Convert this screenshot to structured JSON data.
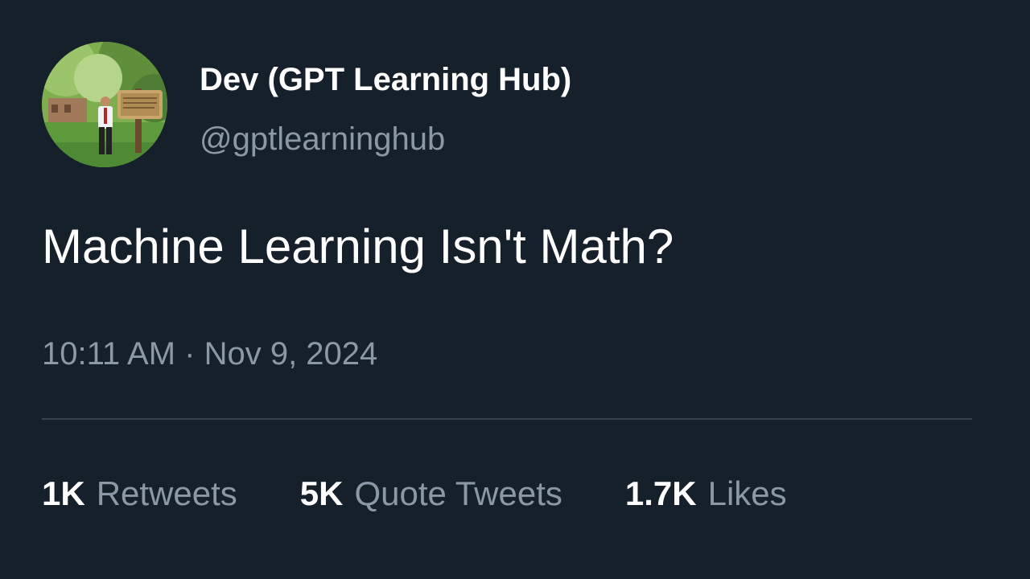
{
  "author": {
    "display_name": "Dev (GPT Learning Hub)",
    "handle": "@gptlearninghub",
    "avatar_icon": "profile-photo"
  },
  "tweet": {
    "text": "Machine Learning Isn't Math?",
    "timestamp": "10:11 AM · Nov 9, 2024"
  },
  "stats": {
    "retweets": {
      "count": "1K",
      "label": "Retweets"
    },
    "quote_tweets": {
      "count": "5K",
      "label": "Quote Tweets"
    },
    "likes": {
      "count": "1.7K",
      "label": "Likes"
    }
  },
  "colors": {
    "background": "#15202b",
    "primary_text": "#ffffff",
    "secondary_text": "#8b98a5",
    "divider": "#38444d"
  }
}
